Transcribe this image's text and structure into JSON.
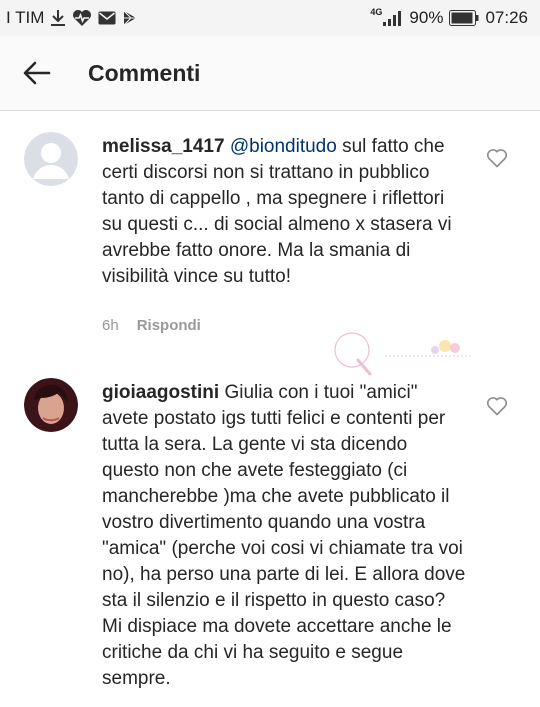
{
  "status_bar": {
    "carrier": "I TIM",
    "network": "4G",
    "battery": "90%",
    "time": "07:26"
  },
  "header": {
    "title": "Commenti",
    "back_icon": "arrow-left-icon"
  },
  "comments": [
    {
      "username": "melissa_1417",
      "mention": "@bionditudo",
      "text": "sul fatto che certi discorsi non si trattano in pubblico tanto di cappello , ma spegnere i riflettori su questi c... di social almeno x stasera vi avrebbe fatto onore. Ma la smania di visibilità vince su tutto!",
      "time": "6h",
      "reply_label": "Rispondi",
      "avatar_icon": "default-avatar-icon"
    },
    {
      "username": "gioiaagostini",
      "text": "Giulia con i tuoi \"amici\" avete postato igs tutti felici e contenti per tutta la sera. La gente vi sta dicendo questo non che avete festeggiato (ci mancherebbe )ma che avete pubblicato il vostro divertimento quando una vostra \"amica\" (perche voi cosi vi chiamate tra voi no), ha perso una parte di lei. E allora dove sta il silenzio e il rispetto in questo caso? Mi dispiace ma dovete accettare anche le critiche da chi vi ha seguito e segue sempre.",
      "avatar_icon": "profile-photo"
    }
  ],
  "colors": {
    "mention": "#003569",
    "meta": "#999999",
    "statusbar_bg": "#f4f4f4"
  }
}
